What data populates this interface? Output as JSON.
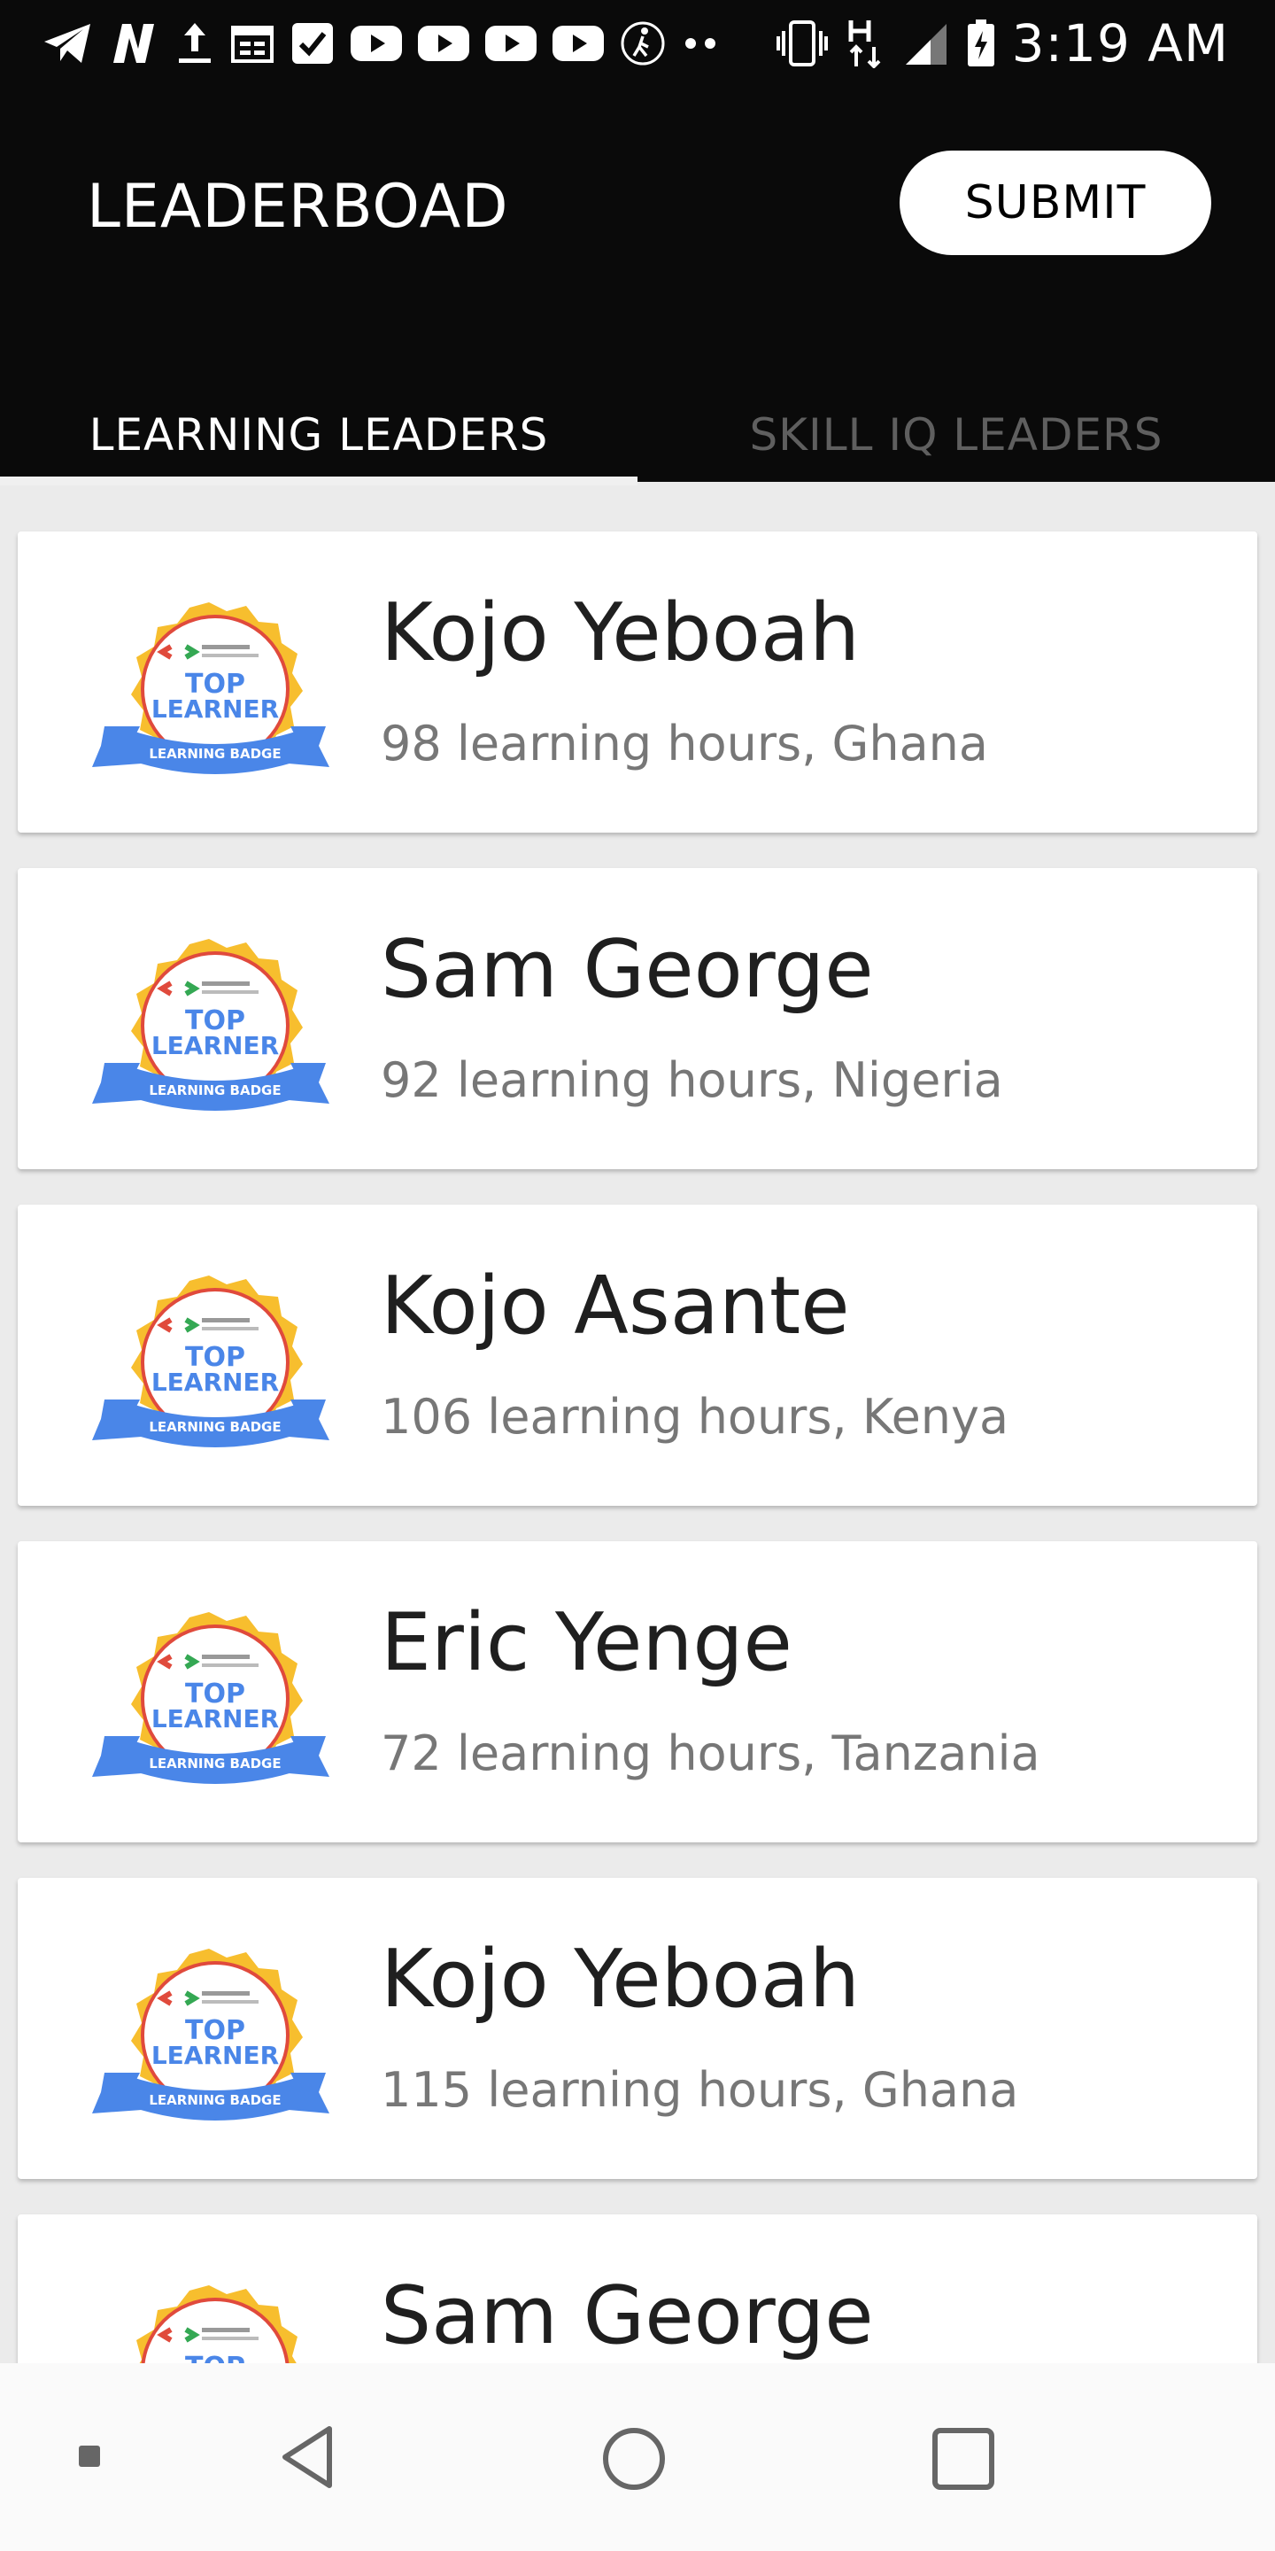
{
  "status_bar": {
    "time": "3:19 AM",
    "left_icons": [
      "telegram-icon",
      "netflix-icon",
      "upload-icon",
      "calendar-icon",
      "checkbox-icon",
      "youtube-icon",
      "youtube-icon",
      "youtube-icon",
      "youtube-icon",
      "walk-icon",
      "more-dots-icon"
    ],
    "right_icons": [
      "vibrate-icon",
      "network-h-icon",
      "signal-icon",
      "battery-icon"
    ]
  },
  "app_bar": {
    "title": "LEADERBOAD",
    "submit_label": "SUBMIT"
  },
  "tabs": [
    {
      "label": "LEARNING LEADERS",
      "active": true
    },
    {
      "label": "SKILL IQ LEADERS",
      "active": false
    }
  ],
  "badge": {
    "line1": "TOP",
    "line2": "LEARNER",
    "ribbon": "LEARNING BADGE",
    "colors": {
      "gold": "#f7be2e",
      "blue": "#4a86e8",
      "red": "#e04a3c",
      "green": "#34a853"
    }
  },
  "leaders": [
    {
      "name": "Kojo Yeboah",
      "details": "98 learning hours, Ghana"
    },
    {
      "name": "Sam George",
      "details": "92 learning hours, Nigeria"
    },
    {
      "name": "Kojo Asante",
      "details": "106 learning hours, Kenya"
    },
    {
      "name": "Eric Yenge",
      "details": "72 learning hours, Tanzania"
    },
    {
      "name": "Kojo Yeboah",
      "details": "115 learning hours, Ghana"
    },
    {
      "name": "Sam George",
      "details": ""
    }
  ],
  "nav_bar": [
    "recents-dot-icon",
    "back-icon",
    "home-icon",
    "overview-icon"
  ]
}
